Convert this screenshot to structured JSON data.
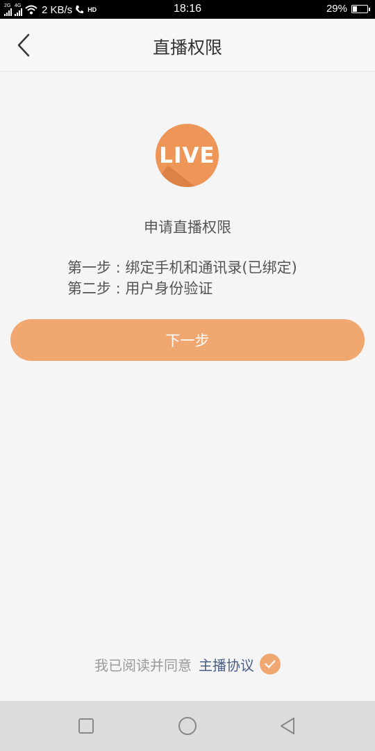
{
  "status_bar": {
    "sim1_tag": "2G",
    "sim2_tag": "4G",
    "net_speed": "2 KB/s",
    "hd_tag": "HD",
    "time": "18:16",
    "battery_percent": "29%",
    "battery_level": 0.29
  },
  "header": {
    "title": "直播权限",
    "back_icon": "chevron-left-icon"
  },
  "logo": {
    "text": "LIVE",
    "color": "#ee9558"
  },
  "content": {
    "apply_title": "申请直播权限",
    "steps": [
      "第一步 : 绑定手机和通讯录(已绑定)",
      "第二步 : 用户身份验证"
    ],
    "next_label": "下一步"
  },
  "agreement": {
    "text": "我已阅读并同意",
    "link": "主播协议",
    "checked": true,
    "check_icon": "check-icon"
  },
  "nav_bar": {
    "recent_icon": "square-icon",
    "home_icon": "circle-icon",
    "back_icon": "triangle-back-icon"
  },
  "colors": {
    "accent": "#f0a770",
    "link": "#4a5f86"
  }
}
